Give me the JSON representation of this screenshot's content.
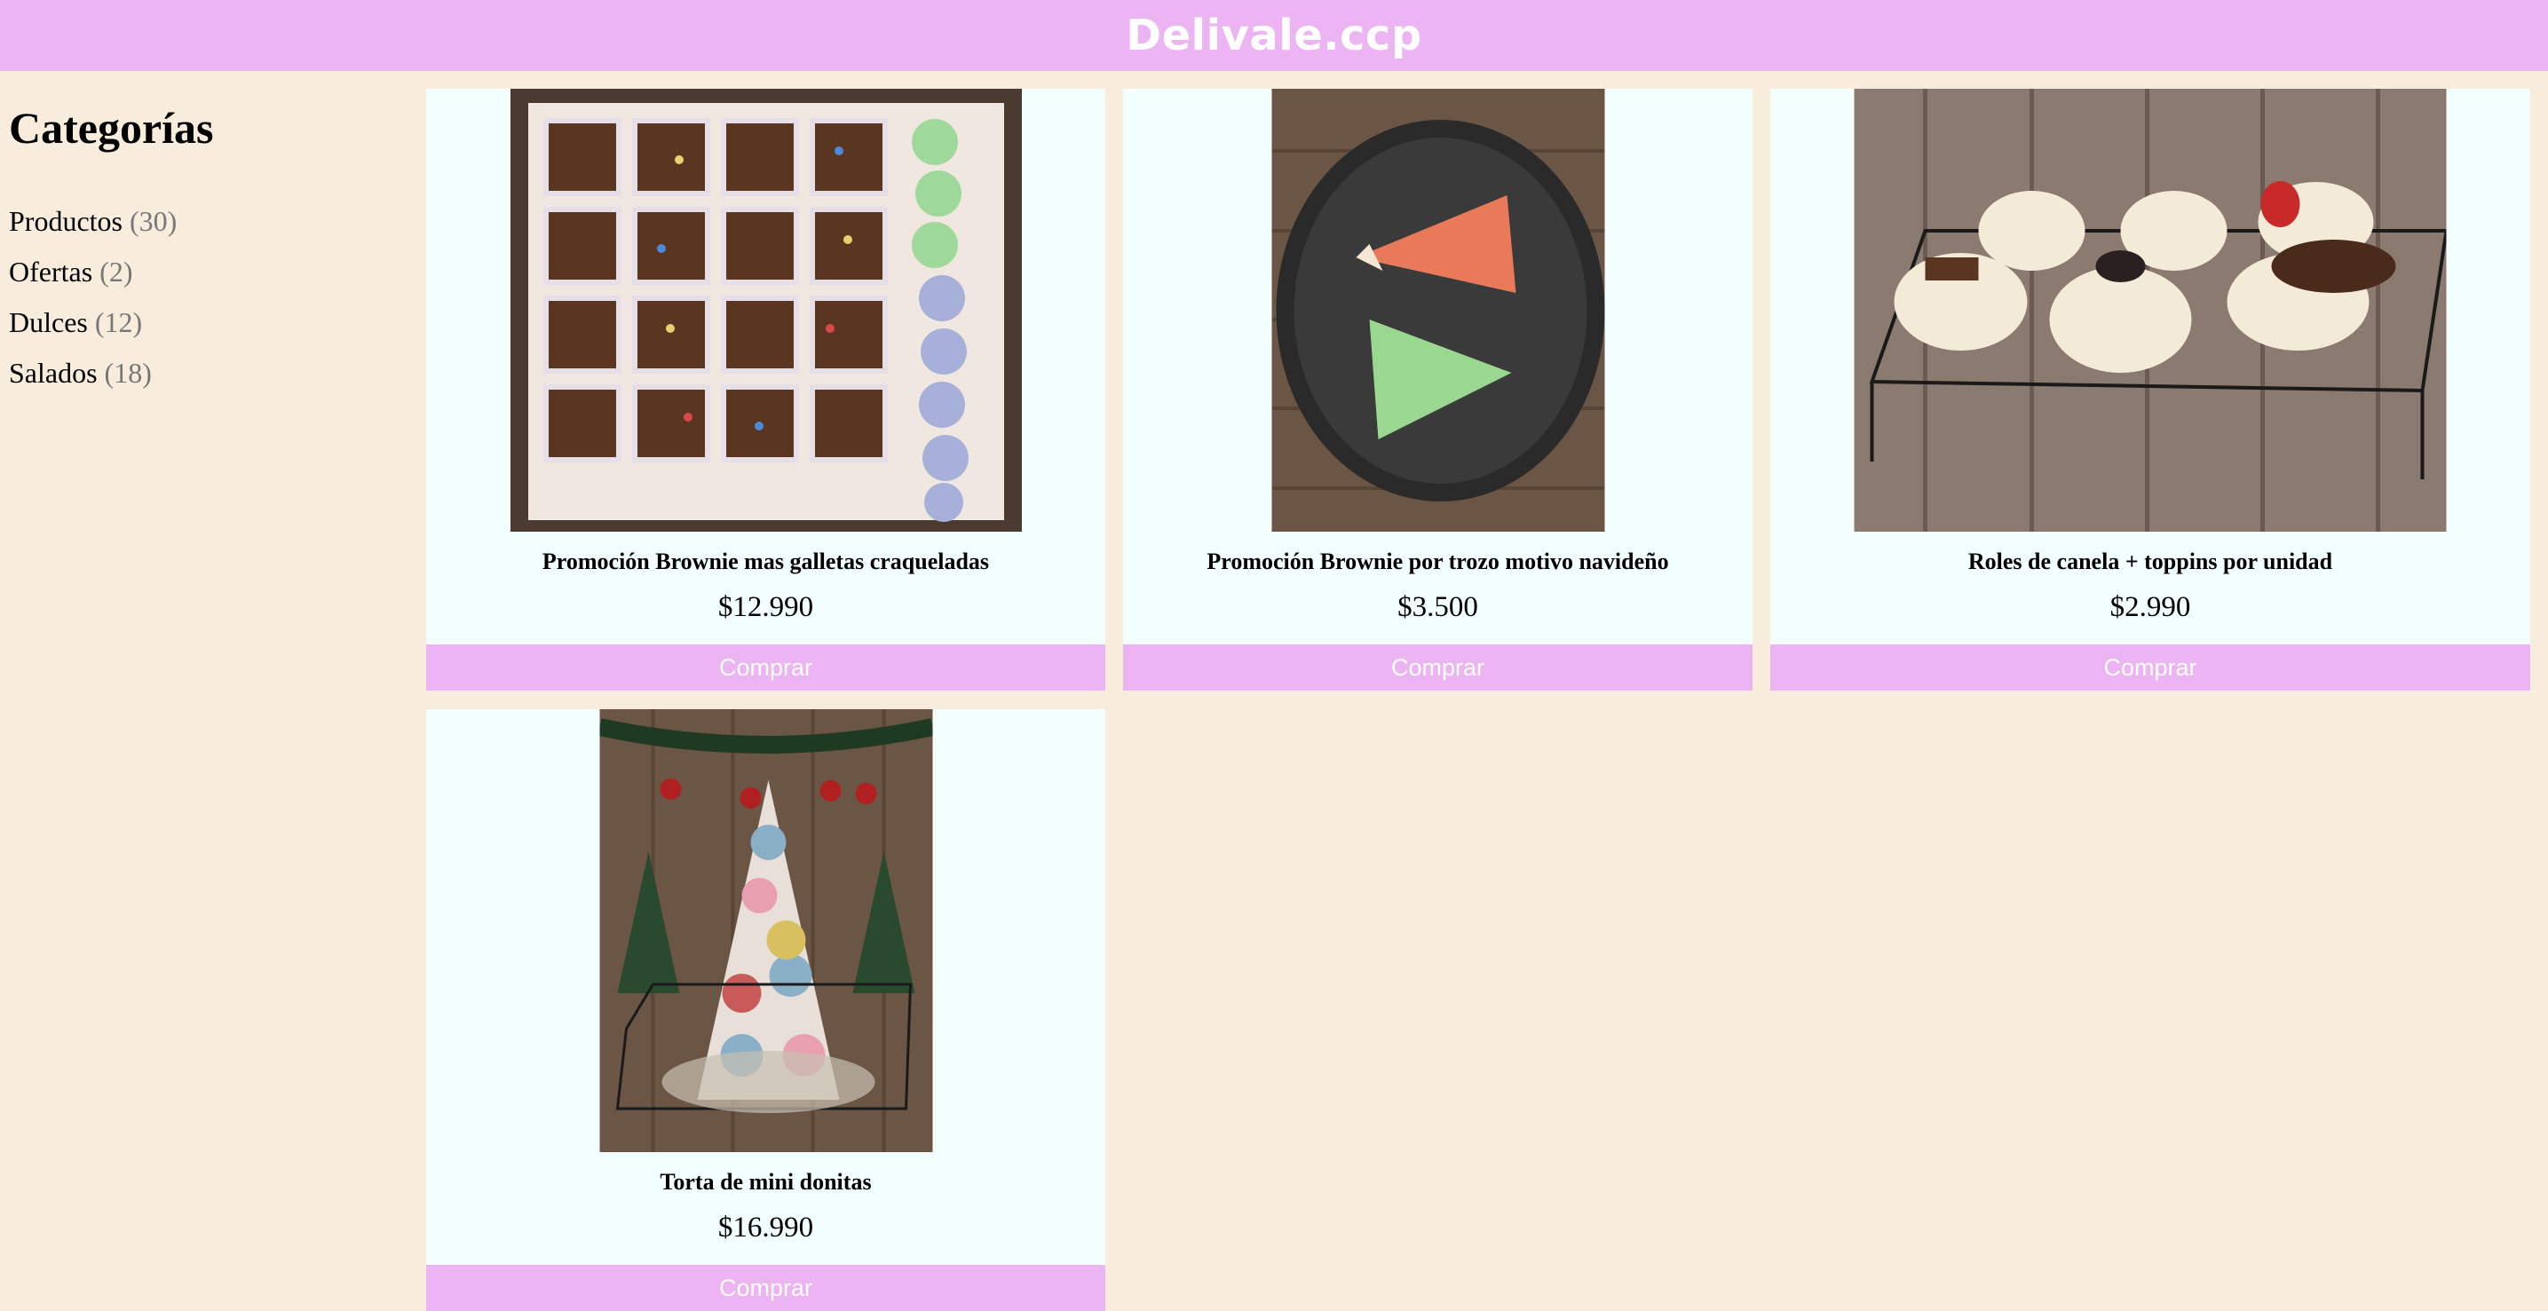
{
  "header": {
    "brand": "Delivale.ccp",
    "color": "#ecb4f2"
  },
  "sidebar": {
    "title": "Categorías",
    "items": [
      {
        "label": "Productos",
        "count": "(30)"
      },
      {
        "label": "Ofertas",
        "count": "(2)"
      },
      {
        "label": "Dulces",
        "count": "(12)"
      },
      {
        "label": "Salados",
        "count": "(18)"
      }
    ]
  },
  "products": [
    {
      "title": "Promoción Brownie mas galletas craqueladas",
      "price": "$12.990",
      "button": "Comprar",
      "image": "brownie-cookies-photo"
    },
    {
      "title": "Promoción Brownie por trozo motivo navideño",
      "price": "$3.500",
      "button": "Comprar",
      "image": "christmas-brownie-slices-photo"
    },
    {
      "title": "Roles de canela + toppins por unidad",
      "price": "$2.990",
      "button": "Comprar",
      "image": "cinnamon-rolls-photo"
    },
    {
      "title": "Torta de mini donitas",
      "price": "$16.990",
      "button": "Comprar",
      "image": "mini-donut-tower-photo"
    }
  ]
}
